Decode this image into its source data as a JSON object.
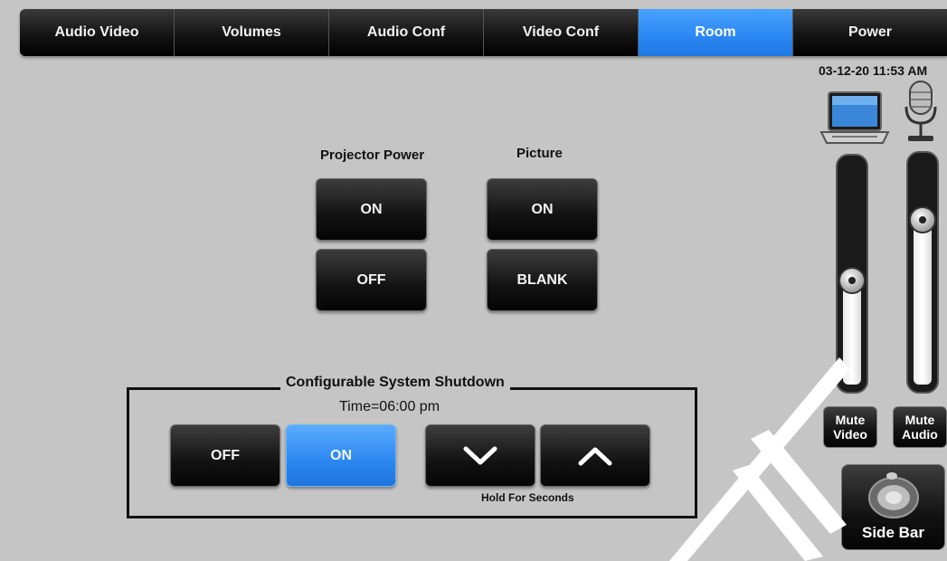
{
  "tabs": [
    {
      "label": "Audio Video",
      "active": false
    },
    {
      "label": "Volumes",
      "active": false
    },
    {
      "label": "Audio Conf",
      "active": false
    },
    {
      "label": "Video Conf",
      "active": false
    },
    {
      "label": "Room",
      "active": true
    },
    {
      "label": "Power",
      "active": false
    }
  ],
  "projector": {
    "label": "Projector Power",
    "on_label": "ON",
    "off_label": "OFF"
  },
  "picture": {
    "label": "Picture",
    "on_label": "ON",
    "blank_label": "BLANK"
  },
  "shutdown": {
    "title": "Configurable System Shutdown",
    "time_text": "Time=06:00 pm",
    "off_label": "OFF",
    "on_label": "ON",
    "on_active": true,
    "down_icon": "chevron-down-icon",
    "up_icon": "chevron-up-icon",
    "hold_label": "Hold For Seconds"
  },
  "status": {
    "datetime": "03-12-20 11:53 AM"
  },
  "faders": {
    "video": {
      "icon": "laptop-icon",
      "level": 0.47,
      "mute_label": "Mute\nVideo"
    },
    "audio": {
      "icon": "microphone-icon",
      "level": 0.73,
      "mute_label": "Mute\nAudio"
    }
  },
  "sidebar": {
    "label": "Side Bar",
    "icon": "sidebar-speaker-icon"
  },
  "colors": {
    "background": "#c5c5c5",
    "accent_blue": "#2a86f2",
    "button_dark": "#121212"
  }
}
